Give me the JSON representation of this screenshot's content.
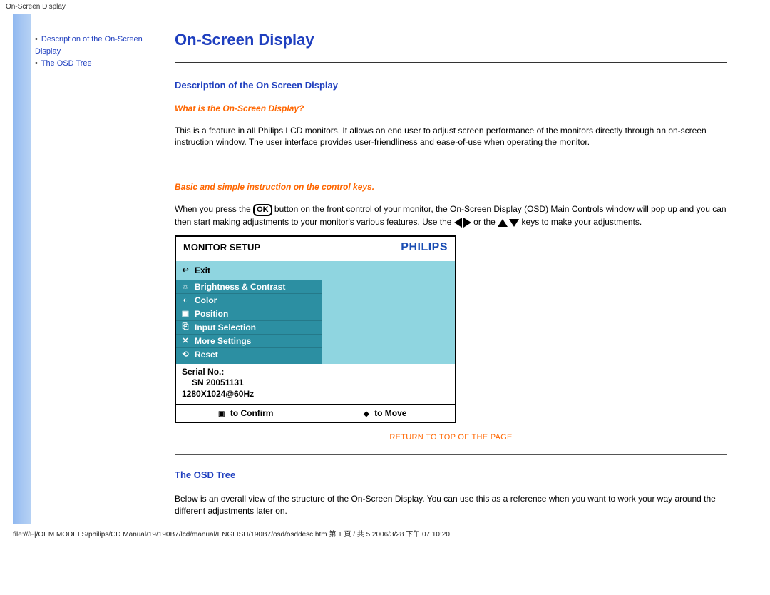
{
  "top_title": "On-Screen Display",
  "sidebar": {
    "items": [
      {
        "label": "Description of the On-Screen Display"
      },
      {
        "label": "The OSD Tree"
      }
    ]
  },
  "page": {
    "title": "On-Screen Display",
    "section1_heading": "Description of the On Screen Display",
    "sub1": "What is the On-Screen Display?",
    "para1": "This is a feature in all Philips LCD monitors. It allows an end user to adjust screen performance of the monitors directly through an on-screen instruction window. The user interface provides user-friendliness and ease-of-use when operating the monitor.",
    "sub2": "Basic and simple instruction on the control keys.",
    "para2_a": "When you press the ",
    "para2_b": " button on the front control of your monitor, the On-Screen Display (OSD) Main Controls window will pop up and you can then start making adjustments to your monitor's various features. Use the ",
    "para2_c": " or the ",
    "para2_d": " keys to make your adjustments.",
    "ok_label": "OK",
    "return_link": "RETURN TO TOP OF THE PAGE",
    "section2_heading": "The OSD Tree",
    "para3": "Below is an overall view of the structure of the On-Screen Display. You can use this as a reference when you want to work your way around the different adjustments later on."
  },
  "osd": {
    "header_title": "MONITOR SETUP",
    "brand": "PHILIPS",
    "items": [
      {
        "label": "Exit",
        "highlight": true
      },
      {
        "label": "Brightness & Contrast"
      },
      {
        "label": "Color"
      },
      {
        "label": "Position"
      },
      {
        "label": "Input Selection"
      },
      {
        "label": "More Settings"
      },
      {
        "label": "Reset"
      }
    ],
    "serial_label": "Serial No.:",
    "serial_value": "SN 20051131",
    "resolution": "1280X1024@60Hz",
    "footer_confirm": "to Confirm",
    "footer_move": "to Move"
  },
  "footer_path": "file:///F|/OEM MODELS/philips/CD Manual/19/190B7/lcd/manual/ENGLISH/190B7/osd/osddesc.htm 第 1 頁 / 共 5 2006/3/28 下午 07:10:20"
}
